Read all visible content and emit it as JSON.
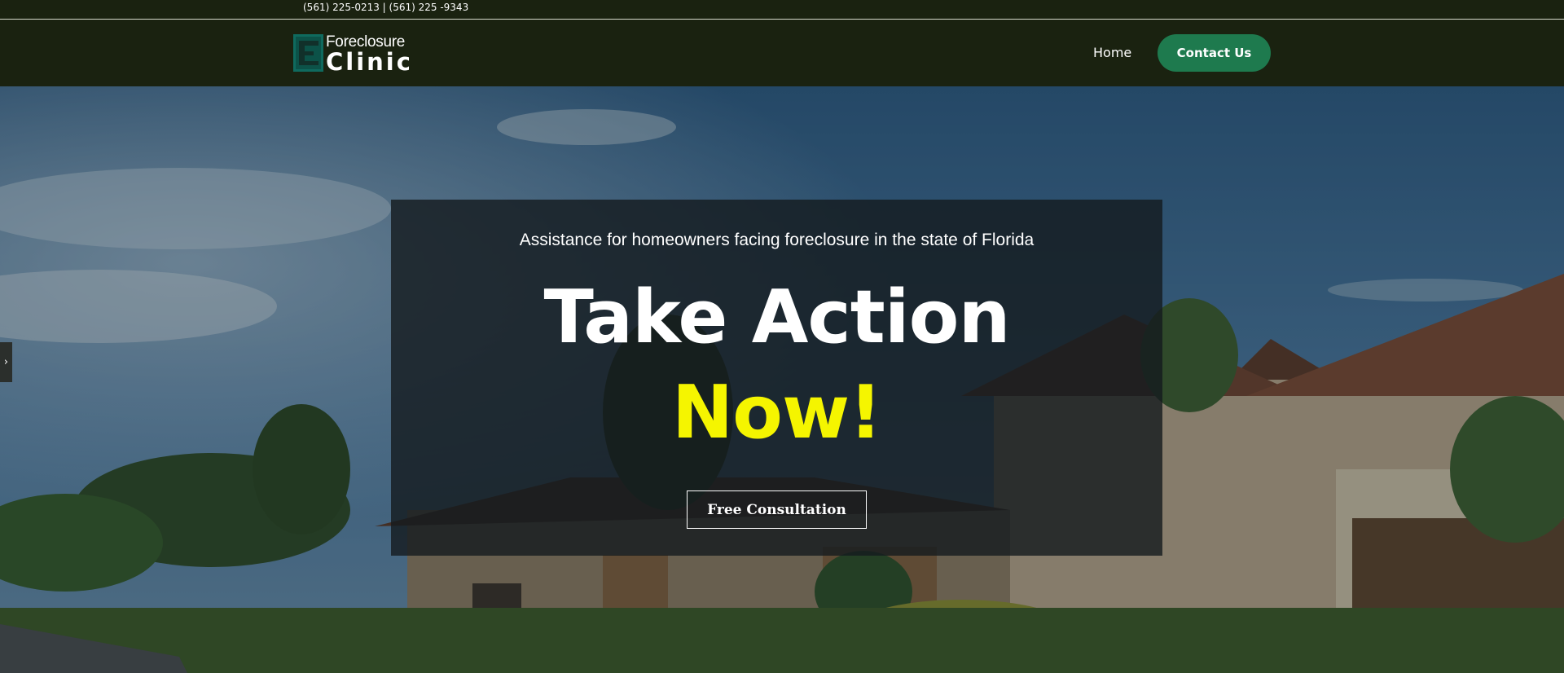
{
  "topbar": {
    "phones": "(561) 225-0213 | (561) 225 -9343"
  },
  "header": {
    "logo": {
      "line1": "Foreclosure",
      "line2": "Clinic"
    },
    "nav": {
      "home_label": "Home",
      "contact_label": "Contact Us"
    }
  },
  "hero": {
    "subtitle": "Assistance for homeowners facing foreclosure in the state of Florida",
    "title_line1": "Take Action",
    "title_line2": "Now!",
    "cta_label": "Free Consultation",
    "side_tab_icon": "chevron-right-icon"
  },
  "colors": {
    "header_bg": "#1a2210",
    "accent_green": "#1e7a4e",
    "headline_yellow": "#f5f500",
    "logo_teal": "#0f6a5e"
  }
}
